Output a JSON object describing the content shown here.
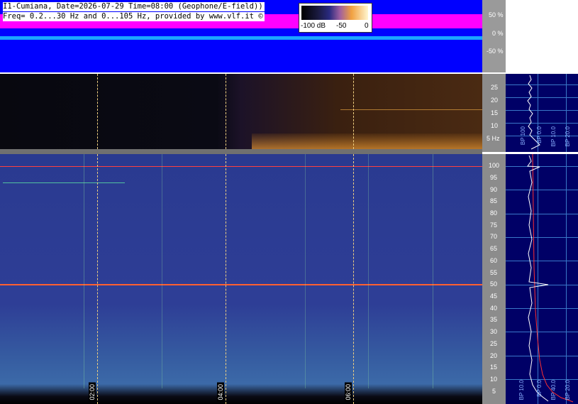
{
  "header": {
    "line1": "I1-Cumiana, Date=2026-07-29 Time=08:00 (Geophone/E-field))",
    "line2": "Freq= 0.2...30 Hz and 0...105 Hz, provided by www.vlf.it ©"
  },
  "scale": {
    "labels": [
      "-100 dB",
      "-50",
      "0"
    ]
  },
  "amplitude_axis": {
    "ticks": [
      "50 %",
      "0 %",
      "-50 %"
    ]
  },
  "upper_spectrogram_axis": {
    "ticks": [
      "25",
      "20",
      "15",
      "10",
      "5 Hz"
    ]
  },
  "lower_spectrogram_axis": {
    "ticks": [
      "100",
      "95",
      "90",
      "85",
      "80",
      "75",
      "70",
      "65",
      "60",
      "55",
      "50",
      "45",
      "40",
      "30",
      "35",
      "25",
      "20",
      "15",
      "10",
      "5"
    ]
  },
  "time_axis": {
    "labels": [
      "02:00",
      "04:00",
      "06:00"
    ]
  },
  "side_panel": {
    "top_labels": [
      "BP 100",
      "BP 0.0",
      "BP 10.0",
      "BP 20.0"
    ],
    "bottom_labels": [
      "BP 10.0",
      "BP 0.0",
      "BP 40.0",
      "BP 20.0"
    ]
  },
  "colors": {
    "amplitude_bg": "#0000ff",
    "amplitude_band": "#ff00ff",
    "schumann_line": "#ff4040",
    "grid": "#3a78c8"
  }
}
